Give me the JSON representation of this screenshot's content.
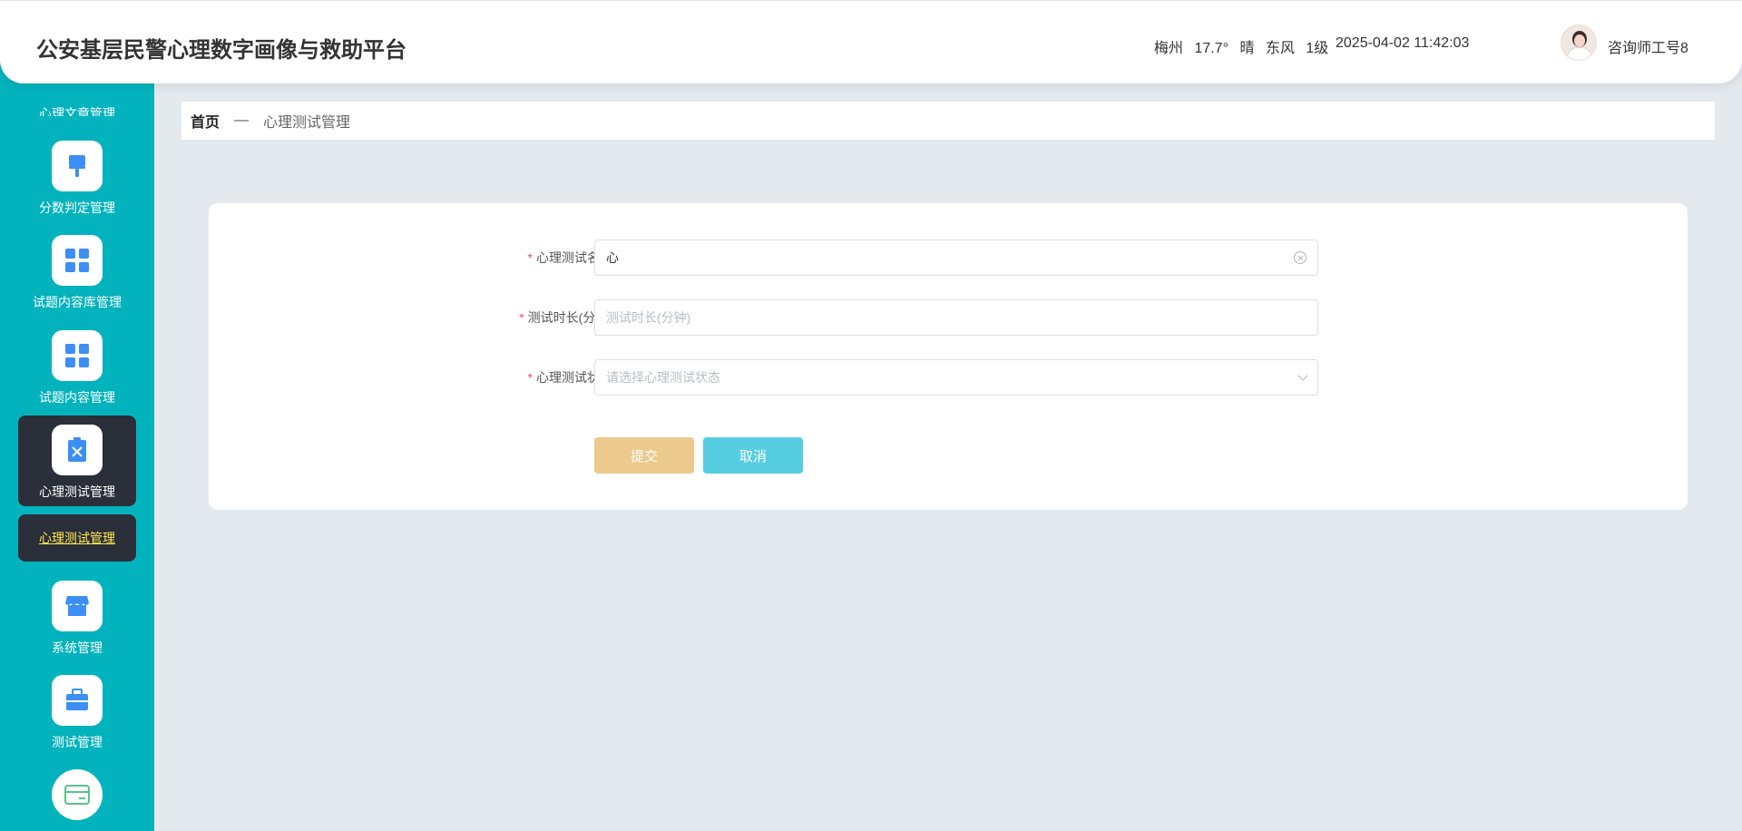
{
  "header": {
    "title": "公安基层民警心理数字画像与救助平台",
    "weather": {
      "city": "梅州",
      "temperature": "17.7°",
      "condition": "晴",
      "wind_dir": "东风",
      "wind_level": "1级"
    },
    "datetime": "2025-04-02 11:42:03",
    "user": "咨询师工号8"
  },
  "sidebar": {
    "cut_label": "心理文章管理",
    "items": [
      {
        "label": "分数判定管理",
        "icon": "brush-icon"
      },
      {
        "label": "试题内容库管理",
        "icon": "grid-icon"
      },
      {
        "label": "试题内容管理",
        "icon": "grid-icon"
      },
      {
        "label": "心理测试管理",
        "icon": "clipboard-x-icon",
        "active": true
      },
      {
        "label": "系统管理",
        "icon": "store-icon"
      },
      {
        "label": "测试管理",
        "icon": "briefcase-icon"
      },
      {
        "label": "",
        "icon": "card-icon"
      }
    ],
    "submenu": {
      "label": "心理测试管理"
    }
  },
  "breadcrumb": {
    "home": "首页",
    "separator": "—",
    "current": "心理测试管理"
  },
  "form": {
    "name_field": {
      "label": "心理测试名称",
      "value": "心"
    },
    "duration_field": {
      "label": "测试时长(分钟)",
      "placeholder": "测试时长(分钟)"
    },
    "status_field": {
      "label": "心理测试状态",
      "placeholder": "请选择心理测试状态"
    },
    "submit_label": "提交",
    "cancel_label": "取消",
    "required_mark": "*"
  },
  "colors": {
    "sidebar": "#02b3bd",
    "active": "#2b2f3a",
    "submenu_text": "#ffe84d",
    "submit": "#ecc98d",
    "cancel": "#56cde0",
    "icon_blue": "#3d8ef5"
  }
}
